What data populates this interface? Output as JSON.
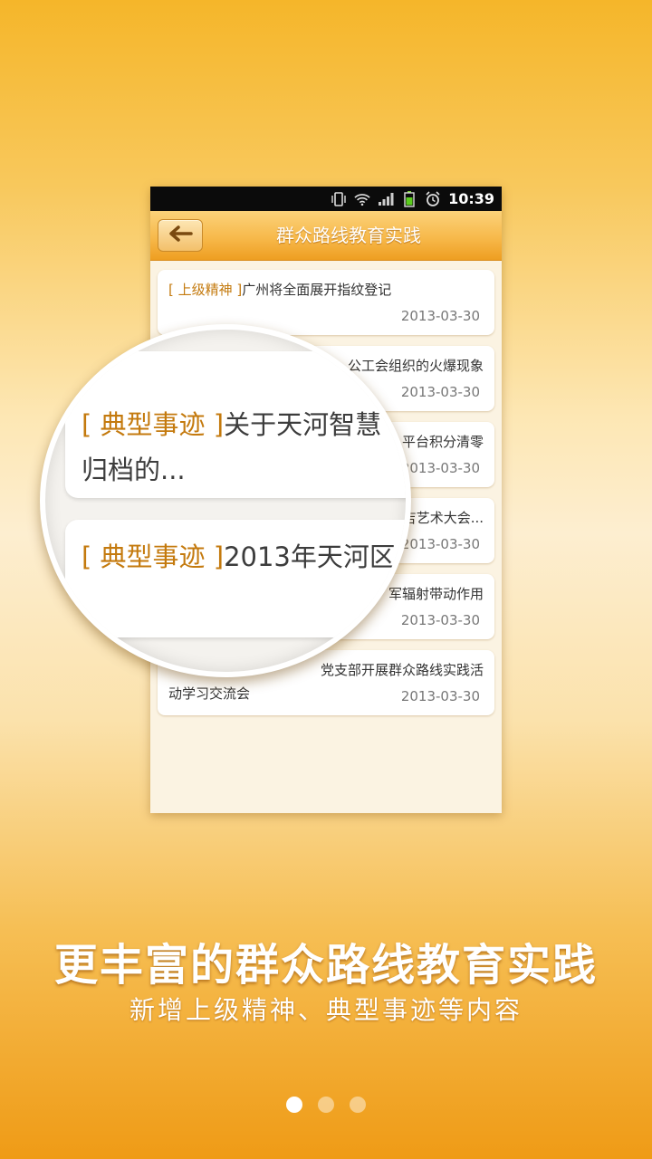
{
  "status_bar": {
    "time": "10:39"
  },
  "app_bar": {
    "title": "群众路线教育实践"
  },
  "list_items": [
    {
      "tag": "[ 上级精神 ]",
      "title": "广州将全面展开指纹登记",
      "title_line2": "",
      "date": "2013-03-30"
    },
    {
      "tag": "",
      "title": "公工会组织的火爆现象",
      "title_line2": "",
      "date": "2013-03-30"
    },
    {
      "tag": "",
      "title": "平台积分清零",
      "title_line2": "",
      "date": "2013-03-30"
    },
    {
      "tag": "",
      "title": "吉艺术大会...",
      "title_line2": "",
      "date": "2013-03-30"
    },
    {
      "tag": "",
      "title": "军辐射带动作用",
      "title_line2": "",
      "date": "2013-03-30"
    },
    {
      "tag": "",
      "title": "党支部开展群众路线实践活",
      "title_line2": "动学习交流会",
      "date": "2013-03-30"
    }
  ],
  "magnifier": {
    "card1": {
      "tag": "[ 典型事迹 ]",
      "text": "关于天河智慧",
      "line2": "归档的..."
    },
    "card2": {
      "tag": "[ 典型事迹 ]",
      "text": "2013年天河区"
    }
  },
  "headline": "更丰富的群众路线教育实践",
  "subheadline": "新增上级精神、典型事迹等内容",
  "pager": {
    "total": 3,
    "active": 1
  },
  "colors": {
    "accent": "#c47a0e",
    "appbar": "#f7b94b"
  }
}
